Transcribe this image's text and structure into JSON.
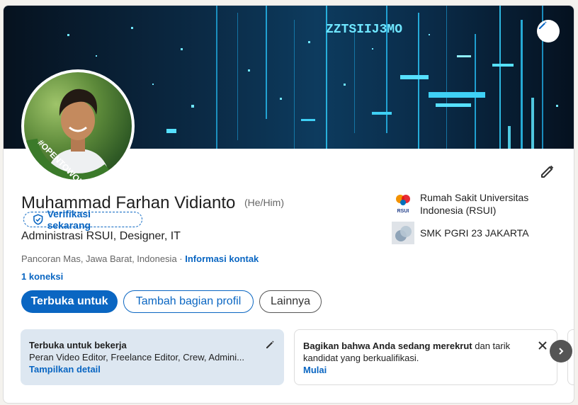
{
  "profile": {
    "name": "Muhammad Farhan Vidianto",
    "pronouns": "(He/Him)",
    "verify_label": "Verifikasi sekarang",
    "headline": "Administrasi RSUI, Designer, IT",
    "location": "Pancoran Mas, Jawa Barat, Indonesia",
    "location_separator": " · ",
    "contact_info_label": "Informasi kontak",
    "connections": "1 koneksi",
    "avatar_badge": "#OPENTOWORK",
    "banner_text": "ZZTSIIJ3MO"
  },
  "actions": {
    "open_to": "Terbuka untuk",
    "add_section": "Tambah bagian profil",
    "more": "Lainnya"
  },
  "organizations": [
    {
      "name": "Rumah Sakit Universitas Indonesia (RSUI)",
      "logo_text": "RSUI"
    },
    {
      "name": "SMK PGRI 23 JAKARTA"
    }
  ],
  "panels": {
    "open_to_work": {
      "title": "Terbuka untuk bekerja",
      "roles": "Peran Video Editor, Freelance Editor, Crew, Admini...",
      "link": "Tampilkan detail"
    },
    "hiring": {
      "text_bold": "Bagikan bahwa Anda sedang merekrut",
      "text_rest": " dan tarik kandidat yang berkualifikasi.",
      "link": "Mulai"
    }
  },
  "icons": {
    "banner_edit": "pencil-icon",
    "profile_edit": "pencil-icon",
    "verify": "shield-check-icon",
    "panel_edit": "pencil-icon",
    "close": "close-icon",
    "next": "chevron-right-icon"
  },
  "colors": {
    "accent": "#0a66c2",
    "open_to_work_green": "#3b7a2a",
    "panel_bg": "#dde7f1"
  }
}
